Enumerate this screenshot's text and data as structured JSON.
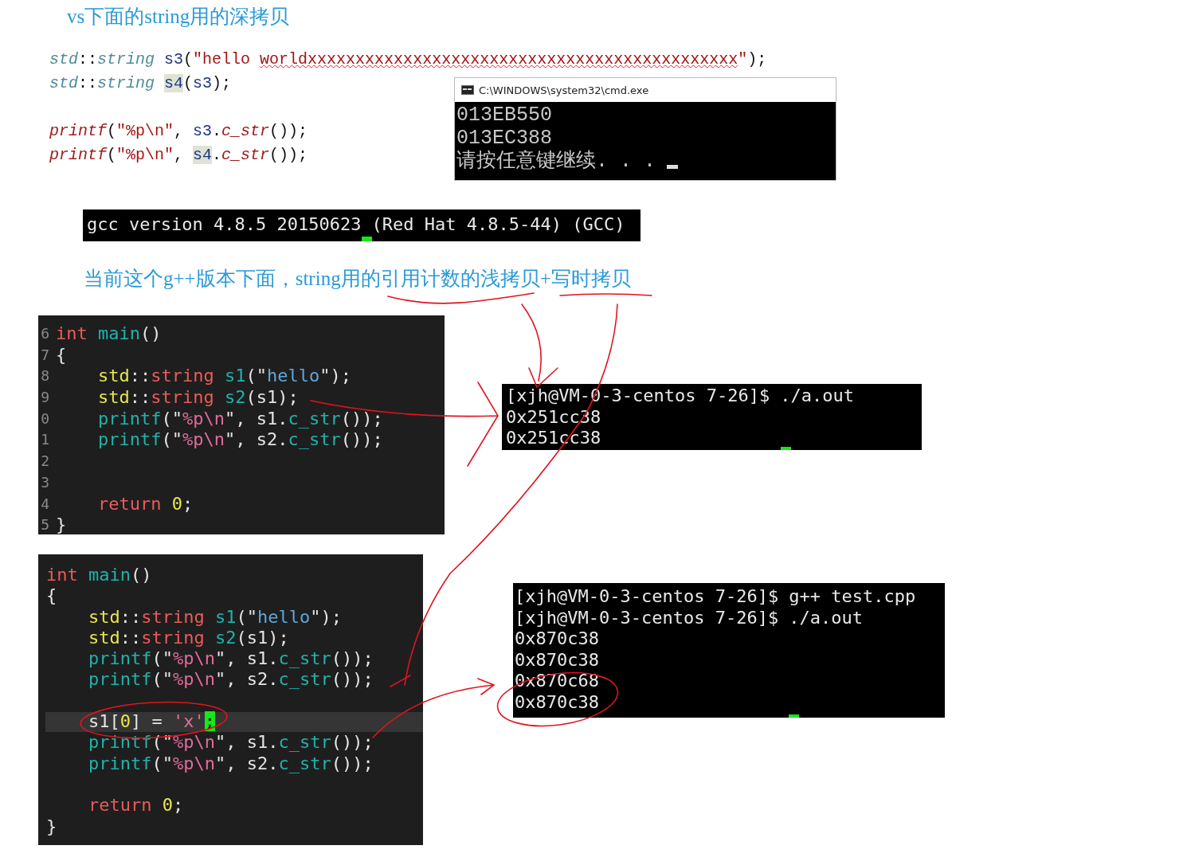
{
  "vs_heading": "vs下面的string用的深拷贝",
  "vs_code": {
    "first_line": [
      {
        "kind": "ns",
        "text": "std"
      },
      {
        "kind": "p",
        "text": "::"
      },
      {
        "kind": "ns",
        "text": "string "
      },
      {
        "kind": "var",
        "text": "s3"
      },
      {
        "kind": "p",
        "text": "("
      },
      {
        "kind": "str",
        "text": "\"hello "
      },
      {
        "kind": "squiggle",
        "text": "worldxxxxxxxxxxxxxxxxxxxxxxxxxxxxxxxxxxxxxxxxxxxxx"
      },
      {
        "kind": "str",
        "text": "\""
      },
      {
        "kind": "p",
        "text": ");"
      }
    ],
    "lines": [
      {
        "blank_before": false,
        "tokens": [
          {
            "kind": "ns",
            "text": "std"
          },
          {
            "kind": "p",
            "text": "::"
          },
          {
            "kind": "ns",
            "text": "string "
          },
          {
            "kind": "hl",
            "text": "s4"
          },
          {
            "kind": "p",
            "text": "("
          },
          {
            "kind": "var",
            "text": "s3"
          },
          {
            "kind": "p",
            "text": ");"
          }
        ]
      },
      {
        "blank_before": true,
        "tokens": [
          {
            "kind": "fn",
            "text": "printf"
          },
          {
            "kind": "p",
            "text": "("
          },
          {
            "kind": "str",
            "text": "\"%p\\n\""
          },
          {
            "kind": "p",
            "text": ", "
          },
          {
            "kind": "var",
            "text": "s3"
          },
          {
            "kind": "p",
            "text": "."
          },
          {
            "kind": "fn",
            "text": "c_str"
          },
          {
            "kind": "p",
            "text": "());"
          }
        ]
      },
      {
        "blank_before": false,
        "tokens": [
          {
            "kind": "fn",
            "text": "printf"
          },
          {
            "kind": "p",
            "text": "("
          },
          {
            "kind": "str",
            "text": "\"%p\\n\""
          },
          {
            "kind": "p",
            "text": ", "
          },
          {
            "kind": "hl",
            "text": "s4"
          },
          {
            "kind": "p",
            "text": "."
          },
          {
            "kind": "fn",
            "text": "c_str"
          },
          {
            "kind": "p",
            "text": "());"
          }
        ]
      }
    ]
  },
  "vs_console": {
    "title": "C:\\WINDOWS\\system32\\cmd.exe",
    "lines": [
      "013EB550",
      "013EC388",
      "请按任意键继续. . ."
    ]
  },
  "gcc_terminal": {
    "lines": [
      "gcc version 4.8.5 20150623 (Red Hat 4.8.5-44) (GCC)"
    ]
  },
  "gpp_note": "当前这个g++版本下面，string用的引用计数的浅拷贝+写时拷贝",
  "code_block_1": {
    "lines": [
      {
        "number": "6",
        "indented": false,
        "tokens": [
          {
            "kind": "kw",
            "text": "int "
          },
          {
            "kind": "fn",
            "text": "main"
          },
          {
            "kind": "p",
            "text": "()"
          }
        ]
      },
      {
        "number": "7",
        "indented": false,
        "tokens": [
          {
            "kind": "p",
            "text": "{"
          }
        ]
      },
      {
        "number": "8",
        "indented": true,
        "tokens": [
          {
            "kind": "ty",
            "text": "std"
          },
          {
            "kind": "p",
            "text": "::"
          },
          {
            "kind": "kw",
            "text": "string "
          },
          {
            "kind": "fn",
            "text": "s1"
          },
          {
            "kind": "p",
            "text": "(\""
          },
          {
            "kind": "str",
            "text": "hello"
          },
          {
            "kind": "p",
            "text": "\");"
          }
        ]
      },
      {
        "number": "9",
        "indented": true,
        "tokens": [
          {
            "kind": "ty",
            "text": "std"
          },
          {
            "kind": "p",
            "text": "::"
          },
          {
            "kind": "kw",
            "text": "string "
          },
          {
            "kind": "fn",
            "text": "s2"
          },
          {
            "kind": "p",
            "text": "(s1);"
          }
        ]
      },
      {
        "number": "0",
        "indented": true,
        "tokens": [
          {
            "kind": "fn",
            "text": "printf"
          },
          {
            "kind": "p",
            "text": "(\""
          },
          {
            "kind": "fmt",
            "text": "%p\\n"
          },
          {
            "kind": "p",
            "text": "\", s1."
          },
          {
            "kind": "fn",
            "text": "c_str"
          },
          {
            "kind": "p",
            "text": "());"
          }
        ]
      },
      {
        "number": "1",
        "indented": true,
        "tokens": [
          {
            "kind": "fn",
            "text": "printf"
          },
          {
            "kind": "p",
            "text": "(\""
          },
          {
            "kind": "fmt",
            "text": "%p\\n"
          },
          {
            "kind": "p",
            "text": "\", s2."
          },
          {
            "kind": "fn",
            "text": "c_str"
          },
          {
            "kind": "p",
            "text": "());"
          }
        ]
      },
      {
        "number": "2"
      },
      {
        "number": "3"
      },
      {
        "number": "4",
        "indented": true,
        "tokens": [
          {
            "kind": "kw",
            "text": "return "
          },
          {
            "kind": "ty",
            "text": "0"
          },
          {
            "kind": "p",
            "text": ";"
          }
        ]
      },
      {
        "number": "5",
        "indented": false,
        "tokens": [
          {
            "kind": "p",
            "text": "}"
          }
        ]
      }
    ]
  },
  "terminal_1": {
    "lines": [
      "[xjh@VM-0-3-centos 7-26]$ ./a.out",
      "0x251cc38",
      "0x251cc38"
    ]
  },
  "code_block_2": {
    "lines": [
      {
        "current": false,
        "blank_before": false,
        "indented": false,
        "tokens": [
          {
            "kind": "kw",
            "text": "int "
          },
          {
            "kind": "fn",
            "text": "main"
          },
          {
            "kind": "p",
            "text": "()"
          }
        ]
      },
      {
        "current": false,
        "blank_before": false,
        "indented": false,
        "tokens": [
          {
            "kind": "p",
            "text": "{"
          }
        ]
      },
      {
        "current": false,
        "blank_before": false,
        "indented": true,
        "tokens": [
          {
            "kind": "ty",
            "text": "std"
          },
          {
            "kind": "p",
            "text": "::"
          },
          {
            "kind": "kw",
            "text": "string "
          },
          {
            "kind": "fn",
            "text": "s1"
          },
          {
            "kind": "p",
            "text": "(\""
          },
          {
            "kind": "str",
            "text": "hello"
          },
          {
            "kind": "p",
            "text": "\");"
          }
        ]
      },
      {
        "current": false,
        "blank_before": false,
        "indented": true,
        "tokens": [
          {
            "kind": "ty",
            "text": "std"
          },
          {
            "kind": "p",
            "text": "::"
          },
          {
            "kind": "kw",
            "text": "string "
          },
          {
            "kind": "fn",
            "text": "s2"
          },
          {
            "kind": "p",
            "text": "(s1);"
          }
        ]
      },
      {
        "current": false,
        "blank_before": false,
        "indented": true,
        "tokens": [
          {
            "kind": "fn",
            "text": "printf"
          },
          {
            "kind": "p",
            "text": "(\""
          },
          {
            "kind": "fmt",
            "text": "%p\\n"
          },
          {
            "kind": "p",
            "text": "\", s1."
          },
          {
            "kind": "fn",
            "text": "c_str"
          },
          {
            "kind": "p",
            "text": "());"
          }
        ]
      },
      {
        "current": false,
        "blank_before": false,
        "indented": true,
        "tokens": [
          {
            "kind": "fn",
            "text": "printf"
          },
          {
            "kind": "p",
            "text": "(\""
          },
          {
            "kind": "fmt",
            "text": "%p\\n"
          },
          {
            "kind": "p",
            "text": "\", s2."
          },
          {
            "kind": "fn",
            "text": "c_str"
          },
          {
            "kind": "p",
            "text": "());"
          }
        ]
      },
      {
        "current": true,
        "blank_before": true,
        "indented": true,
        "tokens": [
          {
            "kind": "p",
            "text": "s1["
          },
          {
            "kind": "ty",
            "text": "0"
          },
          {
            "kind": "p",
            "text": "] = "
          },
          {
            "kind": "fmt",
            "text": "'x'"
          },
          {
            "kind": "cursor",
            "text": ";"
          }
        ]
      },
      {
        "current": false,
        "blank_before": false,
        "indented": true,
        "tokens": [
          {
            "kind": "fn",
            "text": "printf"
          },
          {
            "kind": "p",
            "text": "(\""
          },
          {
            "kind": "fmt",
            "text": "%p\\n"
          },
          {
            "kind": "p",
            "text": "\", s1."
          },
          {
            "kind": "fn",
            "text": "c_str"
          },
          {
            "kind": "p",
            "text": "());"
          }
        ]
      },
      {
        "current": false,
        "blank_before": false,
        "indented": true,
        "tokens": [
          {
            "kind": "fn",
            "text": "printf"
          },
          {
            "kind": "p",
            "text": "(\""
          },
          {
            "kind": "fmt",
            "text": "%p\\n"
          },
          {
            "kind": "p",
            "text": "\", s2."
          },
          {
            "kind": "fn",
            "text": "c_str"
          },
          {
            "kind": "p",
            "text": "());"
          }
        ]
      },
      {
        "current": false,
        "blank_before": true,
        "indented": true,
        "tokens": [
          {
            "kind": "kw",
            "text": "return "
          },
          {
            "kind": "ty",
            "text": "0"
          },
          {
            "kind": "p",
            "text": ";"
          }
        ]
      },
      {
        "current": false,
        "blank_before": false,
        "indented": false,
        "tokens": [
          {
            "kind": "p",
            "text": "}"
          }
        ]
      }
    ]
  },
  "terminal_2": {
    "lines": [
      "[xjh@VM-0-3-centos 7-26]$ g++ test.cpp",
      "[xjh@VM-0-3-centos 7-26]$ ./a.out",
      "0x870c38",
      "0x870c38",
      "0x870c68",
      "0x870c38"
    ]
  }
}
